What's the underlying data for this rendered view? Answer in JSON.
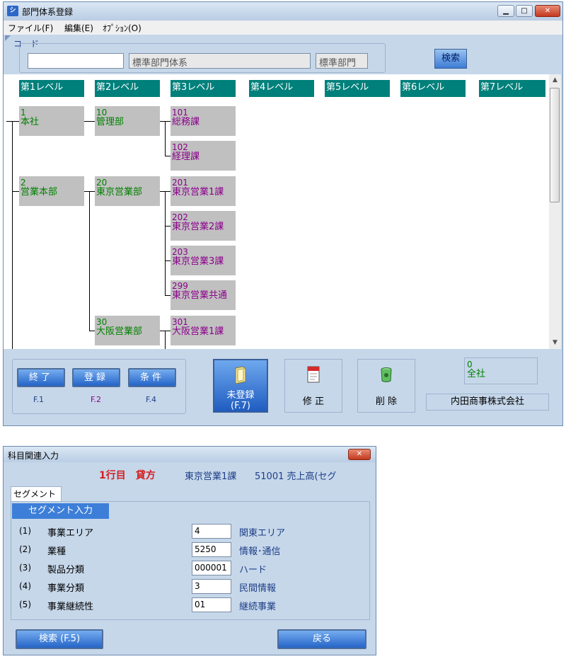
{
  "window1": {
    "title": "部門体系登録",
    "menu": [
      "ファイル(F)",
      "編集(E)",
      "ｵﾌﾟｼｮﾝ(O)"
    ],
    "code_label": "コード",
    "code_value": "",
    "system_name": "標準部門体系",
    "system_type": "標準部門",
    "search_label": "検索",
    "levels": [
      "第1レベル",
      "第2レベル",
      "第3レベル",
      "第4レベル",
      "第5レベル",
      "第6レベル",
      "第7レベル"
    ],
    "nodes": [
      {
        "code": "1",
        "name": "本社"
      },
      {
        "code": "10",
        "name": "管理部"
      },
      {
        "code": "101",
        "name": "総務課"
      },
      {
        "code": "102",
        "name": "経理課"
      },
      {
        "code": "2",
        "name": "営業本部"
      },
      {
        "code": "20",
        "name": "東京営業部"
      },
      {
        "code": "201",
        "name": "東京営業1課"
      },
      {
        "code": "202",
        "name": "東京営業2課"
      },
      {
        "code": "203",
        "name": "東京営業3課"
      },
      {
        "code": "299",
        "name": "東京営業共通"
      },
      {
        "code": "30",
        "name": "大阪営業部"
      },
      {
        "code": "301",
        "name": "大阪営業1課"
      }
    ],
    "buttons": {
      "end": "終了",
      "end_key": "F.1",
      "register": "登録",
      "register_key": "F.2",
      "condition": "条件",
      "condition_key": "F.4",
      "unregistered": "未登録",
      "unregistered_key": "(F.7)",
      "modify": "修 正",
      "delete": "削 除"
    },
    "info_code": "0",
    "info_name": "全社",
    "company": "内田商事株式会社",
    "colors": {
      "teal": "#00807b",
      "green": "#008000",
      "purple": "#8b008b"
    }
  },
  "window2": {
    "title": "科目関連入力",
    "row_label": "1行目　貸方",
    "dept": "東京営業1課",
    "account": "51001 売上高(セグ",
    "tab": "セグメント",
    "section": "セグメント入力",
    "rows": [
      {
        "num": "(1)",
        "label": "事業エリア",
        "value": "4",
        "desc": "関東エリア"
      },
      {
        "num": "(2)",
        "label": "業種",
        "value": "5250",
        "desc": "情報･通信"
      },
      {
        "num": "(3)",
        "label": "製品分類",
        "value": "000001",
        "desc": "ハード"
      },
      {
        "num": "(4)",
        "label": "事業分類",
        "value": "3",
        "desc": "民間情報"
      },
      {
        "num": "(5)",
        "label": "事業継続性",
        "value": "01",
        "desc": "継続事業"
      }
    ],
    "search_btn": "検索 (F.5)",
    "back_btn": "戻る"
  }
}
